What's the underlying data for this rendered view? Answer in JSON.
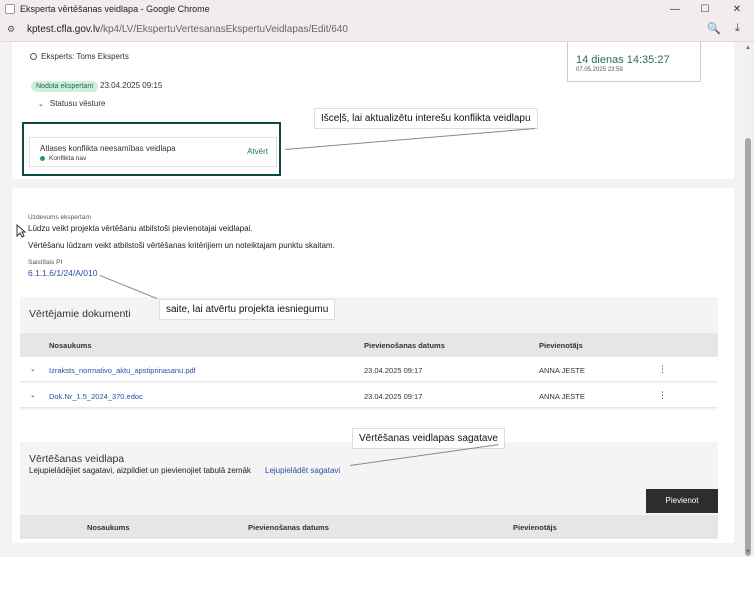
{
  "window": {
    "title": "Eksperta vērtēšanas veidlapa - Google Chrome",
    "minimize": "—",
    "restore": "☐",
    "close": "✕"
  },
  "address": {
    "host": "kptest.cfla.gov.lv",
    "path": "/kp4/LV/EkspertuVertesanasEkspertuVeidlapas/Edit/640",
    "zoom_icon": "🔍",
    "download_icon": "⤓"
  },
  "header": {
    "expert_label": "Eksperts: Toms Eksperts",
    "status_badge": "Nodota ekspertam",
    "status_date": "23.04.2025 09:15",
    "status_history": "Statusu vēsture",
    "deadline_time": "14 dienas 14:35:27",
    "deadline_date": "07.05.2025 23:59"
  },
  "conflict": {
    "title": "Atlases konflikta neesamības veidlapa",
    "status": "Konflikta nav",
    "open_label": "Atvērt"
  },
  "callouts": {
    "conflict": "Išceļš, lai aktualizētu interešu konflikta veidlapu",
    "link": "saite, lai atvērtu projekta iesniegumu",
    "template": "Vērtēšanas veidlapas sagatave"
  },
  "task": {
    "label": "Uzdevums ekspertam",
    "line1": "Lūdzu veikt projekta vērtēšanu atbilstoši pievienotajai veidlapai.",
    "line2": "Vērtēšanu lūdzam veikt atbilstoši vērtēšanas kritērijiem un noteiktajam punktu skaitam.",
    "related_label": "Saistītais PI",
    "related_link": "6.1.1.6/1/24/A/010"
  },
  "documents": {
    "title": "Vērtējamie dokumenti",
    "columns": [
      "Nosaukums",
      "Pievienošanas datums",
      "Pievienotājs"
    ],
    "rows": [
      {
        "name": "Izraksts_normativo_aktu_apstiprinasanu.pdf",
        "date": "23.04.2025 09:17",
        "author": "ANNA JESTE"
      },
      {
        "name": "Dok.Nr_1.5_2024_370.edoc",
        "date": "23.04.2025 09:17",
        "author": "ANNA JESTE"
      }
    ]
  },
  "form": {
    "title": "Vērtēšanas veidlapa",
    "instruction": "Lejupielādējiet sagatavi, aizpildiet un pievienojiet tabulā zemāk",
    "download_link": "Lejupielādēt sagatavi",
    "add_button": "Pievienot",
    "columns": [
      "Nosaukums",
      "Pievienošanas datums",
      "Pievienotājs"
    ]
  },
  "colors": {
    "accent_green": "#0c4a45",
    "link_blue": "#2b4fa0",
    "badge_bg": "#cfeedd"
  }
}
